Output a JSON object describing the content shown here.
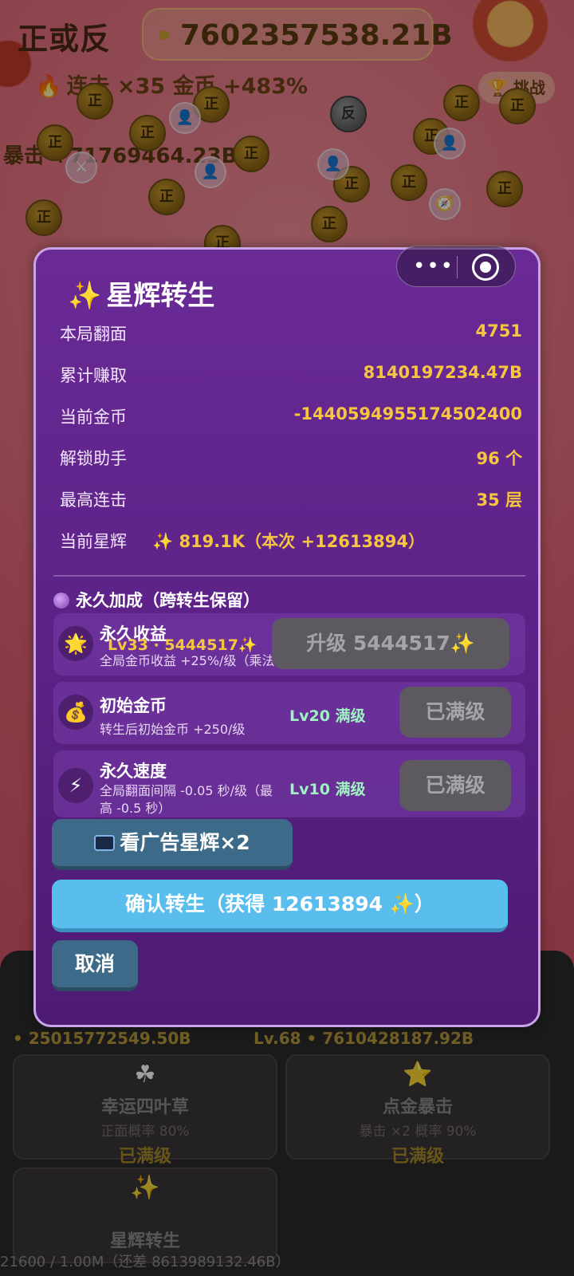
{
  "game": {
    "title": "正或反",
    "coins": "7602357538.21B",
    "combo": "连击 ×35 金币 +483%",
    "challenge_label": "挑战",
    "crit_text": "暴击 +71769464.23B",
    "coin_glyph": "正",
    "coin_glyph_back": "反"
  },
  "menu_capsule": {
    "more": "•••"
  },
  "modal": {
    "title": "星辉转生",
    "stats": [
      {
        "label": "本局翻面",
        "value": "4751"
      },
      {
        "label": "累计赚取",
        "value": "8140197234.47B"
      },
      {
        "label": "当前金币",
        "value": "-1440594955174502400"
      },
      {
        "label": "解锁助手",
        "value": "96 个"
      },
      {
        "label": "最高连击",
        "value": "35 层"
      },
      {
        "label": "当前星辉",
        "value": "✨ 819.1K（本次 +12613894）"
      }
    ],
    "permanent_header": "永久加成（跨转生保留）",
    "permanent": [
      {
        "name": "永久收益",
        "level": "Lv33 · 5444517✨",
        "desc": "全局金币收益 +25%/级（乘法",
        "button": "升级 5444517✨",
        "icon": "sun-icon"
      },
      {
        "name": "初始金币",
        "level": "Lv20 满级",
        "desc": "转生后初始金币 +250/级",
        "button": "已满级",
        "icon": "money-bag-icon"
      },
      {
        "name": "永久速度",
        "level": "Lv10 满级",
        "desc": "全局翻面间隔 -0.05 秒/级（最高 -0.5 秒）",
        "button": "已满级",
        "icon": "lightning-icon"
      }
    ],
    "ad_button": "看广告星辉×2",
    "confirm_button": "确认转生（获得 12613894 ✨）",
    "cancel_button": "取消"
  },
  "bottom": {
    "row_left": "• 25015772549.50B",
    "row_right": "Lv.68 • 7610428187.92B",
    "cards": [
      {
        "name": "幸运四叶草",
        "desc": "正面概率 80%",
        "status": "已满级"
      },
      {
        "name": "点金暴击",
        "desc": "暴击 ×2 概率 90%",
        "status": "已满级"
      },
      {
        "name": "星辉转生",
        "desc": "",
        "status": ""
      }
    ],
    "footer": "21600 / 1.00M（还差 8613989132.46B）"
  }
}
